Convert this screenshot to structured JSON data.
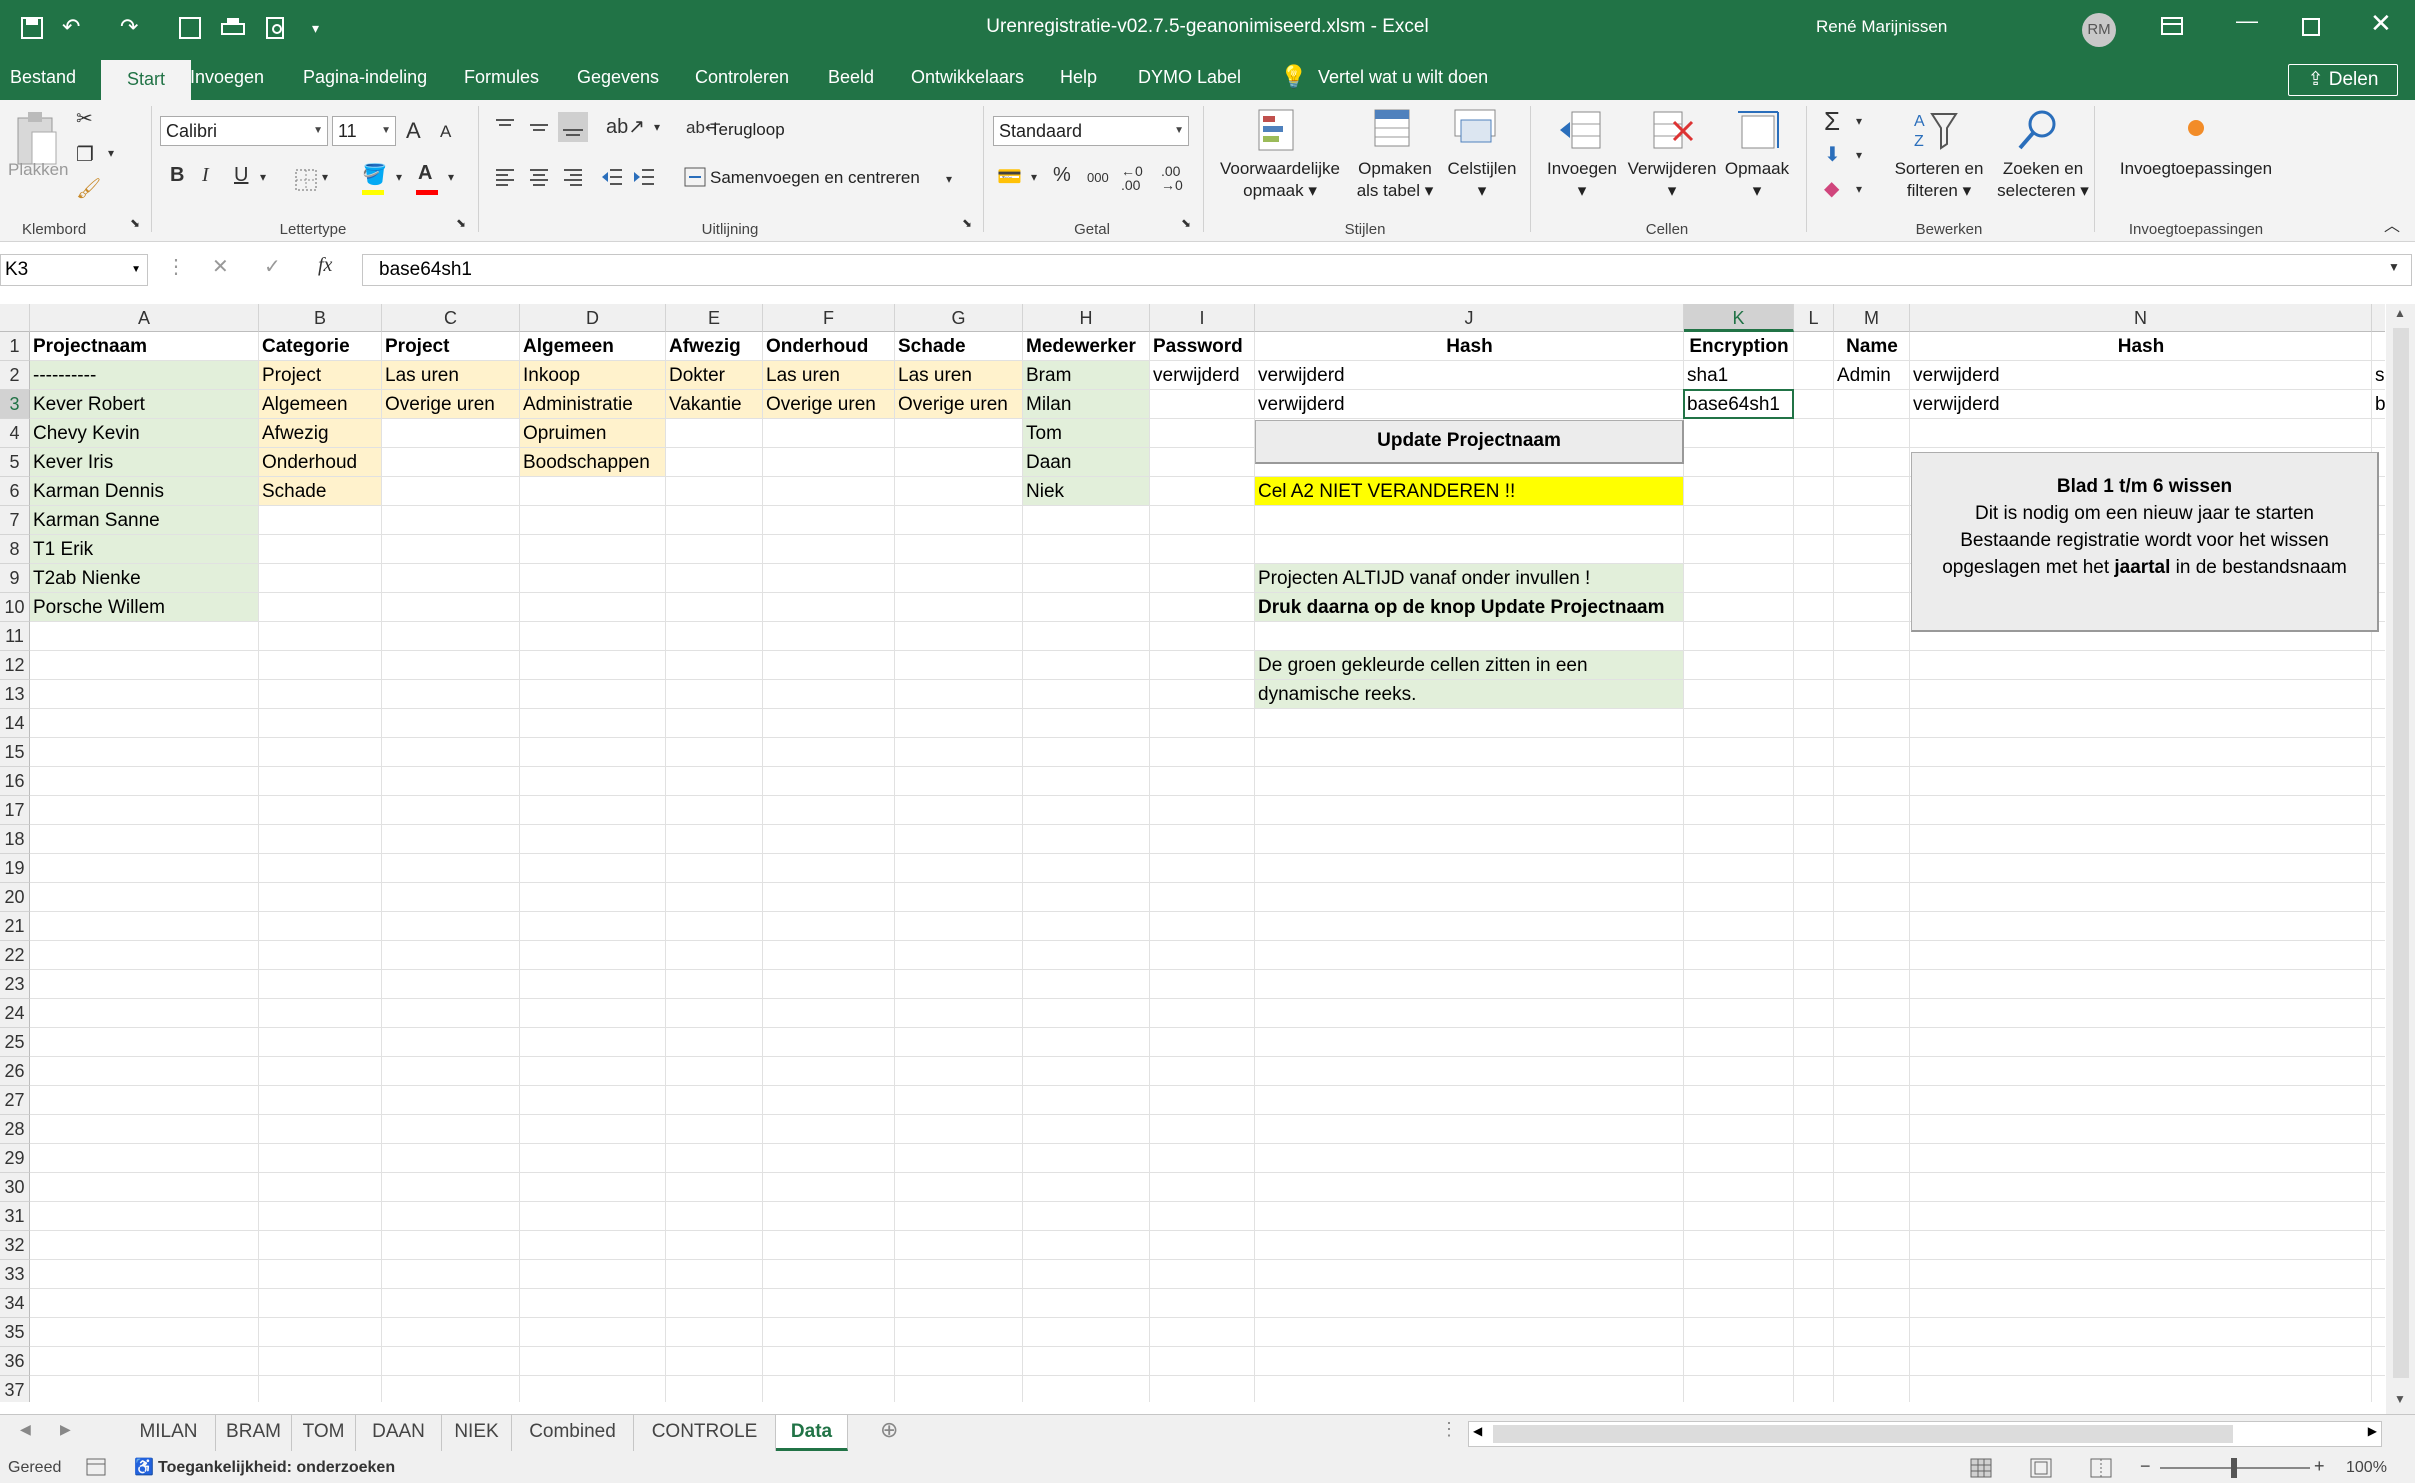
{
  "title_bar": {
    "window_title": "Urenregistratie-v02.7.5-geanonimiseerd.xlsm  -  Excel",
    "user_name": "René Marijnissen",
    "user_initials": "RM"
  },
  "menu": {
    "tabs": [
      "Bestand",
      "Start",
      "Invoegen",
      "Pagina-indeling",
      "Formules",
      "Gegevens",
      "Controleren",
      "Beeld",
      "Ontwikkelaars",
      "Help",
      "DYMO Label",
      "Vertel wat u wilt doen"
    ],
    "active": "Start",
    "share_label": "Delen"
  },
  "ribbon": {
    "clipboard": {
      "paste_label": "Plakken",
      "group_label": "Klembord"
    },
    "font": {
      "name": "Calibri",
      "size": "11",
      "group_label": "Lettertype",
      "bold": "B",
      "italic": "I",
      "underline": "U",
      "grow": "A",
      "shrink": "A",
      "fill_color": "#FFFF00",
      "font_color": "#FF0000"
    },
    "alignment": {
      "wrap_label": "Terugloop",
      "merge_label": "Samenvoegen en centreren",
      "group_label": "Uitlijning"
    },
    "number": {
      "format": "Standaard",
      "group_label": "Getal",
      "percent": "%",
      "thousands": "000"
    },
    "styles": {
      "conditional_l1": "Voorwaardelijke",
      "conditional_l2": "opmaak",
      "table_l1": "Opmaken",
      "table_l2": "als tabel",
      "cell_styles": "Celstijlen",
      "group_label": "Stijlen"
    },
    "cells": {
      "insert": "Invoegen",
      "delete": "Verwijderen",
      "format": "Opmaak",
      "group_label": "Cellen"
    },
    "editing": {
      "sort_l1": "Sorteren en",
      "sort_l2": "filteren",
      "find_l1": "Zoeken en",
      "find_l2": "selecteren",
      "group_label": "Bewerken"
    },
    "addins": {
      "label": "Invoegtoepassingen",
      "group_label": "Invoegtoepassingen"
    }
  },
  "formula_bar": {
    "name_box": "K3",
    "fx": "fx",
    "formula": "base64sh1"
  },
  "columns": [
    "A",
    "B",
    "C",
    "D",
    "E",
    "F",
    "G",
    "H",
    "I",
    "J",
    "K",
    "L",
    "M",
    "N",
    "E"
  ],
  "rows": [
    "1",
    "2",
    "3",
    "4",
    "5",
    "6",
    "7",
    "8",
    "9",
    "10",
    "11",
    "12",
    "13",
    "14",
    "15",
    "16",
    "17",
    "18",
    "19",
    "20",
    "21",
    "22",
    "23",
    "24",
    "25",
    "26",
    "27",
    "28",
    "29",
    "30",
    "31",
    "32",
    "33",
    "34",
    "35",
    "36",
    "37"
  ],
  "headers": {
    "A": "Projectnaam",
    "B": "Categorie",
    "C": "Project",
    "D": "Algemeen",
    "E": "Afwezig",
    "F": "Onderhoud",
    "G": "Schade",
    "H": "Medewerker",
    "I": "Password",
    "J": "Hash",
    "K": "Encryption",
    "M": "Name",
    "N": "Hash"
  },
  "colA": [
    "----------",
    "Kever Robert",
    "Chevy Kevin",
    "Kever Iris",
    "Karman Dennis",
    "Karman Sanne",
    "T1 Erik",
    "T2ab Nienke",
    "Porsche Willem"
  ],
  "colB": [
    "Project",
    "Algemeen",
    "Afwezig",
    "Onderhoud",
    "Schade"
  ],
  "colC": [
    "Las uren",
    "Overige uren"
  ],
  "colD": [
    "Inkoop",
    "Administratie",
    "Opruimen",
    "Boodschappen"
  ],
  "colE": [
    "Dokter",
    "Vakantie"
  ],
  "colF": [
    "Las uren",
    "Overige uren"
  ],
  "colG": [
    "Las uren",
    "Overige uren"
  ],
  "colH": [
    "Bram",
    "Milan",
    "Tom",
    "Daan",
    "Niek"
  ],
  "colI": [
    "verwijderd"
  ],
  "colJ": [
    "verwijderd",
    "verwijderd"
  ],
  "colK": [
    "sha1",
    "base64sh1"
  ],
  "colM": [
    "Admin"
  ],
  "colN": [
    "verwijderd",
    "verwijderd"
  ],
  "colO": [
    "s",
    "b"
  ],
  "notes": {
    "warning": "Cel A2 NIET VERANDEREN !!",
    "instr1": "Projecten ALTIJD vanaf onder invullen !",
    "instr2": "Druk daarna op de knop Update Projectnaam",
    "info1": "De groen gekleurde cellen zitten in een",
    "info2": "dynamische reeks."
  },
  "update_button": "Update Projectnaam",
  "clear_button": {
    "title": "Blad 1 t/m 6 wissen",
    "line1": "Dit is nodig om een nieuw jaar te starten",
    "line2": "Bestaande registratie wordt voor het wissen",
    "line3a": "opgeslagen met het ",
    "line3b": "jaartal",
    "line3c": " in de bestandsnaam"
  },
  "sheet_tabs": [
    "MILAN",
    "BRAM",
    "TOM",
    "DAAN",
    "NIEK",
    "Combined",
    "CONTROLE",
    "Data"
  ],
  "active_sheet": "Data",
  "status": {
    "ready": "Gereed",
    "accessibility": "Toegankelijkheid: onderzoeken",
    "zoom": "100%"
  },
  "colors": {
    "excel_green": "#217346",
    "green_fill": "#E2EFDA",
    "orange_fill": "#FFF2CC",
    "yellow_fill": "#FFFF00"
  }
}
